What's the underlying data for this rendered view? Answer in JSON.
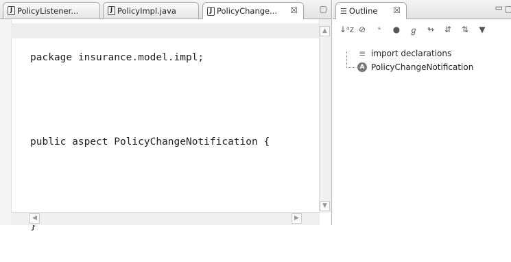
{
  "editor": {
    "tabs": [
      {
        "label": "PolicyListener...",
        "icon": "java-file-icon"
      },
      {
        "label": "PolicyImpl.java",
        "icon": "java-file-icon"
      },
      {
        "label": "PolicyChange...",
        "icon": "java-file-icon",
        "active": true
      }
    ],
    "tab_close_glyph": "☒",
    "code_lines": [
      "package insurance.model.impl;",
      "",
      "public aspect PolicyChangeNotification {",
      "",
      "}"
    ]
  },
  "outline": {
    "title": "Outline",
    "close_glyph": "☒",
    "toolbar": [
      {
        "name": "sort-icon",
        "glyph": "↓ᵃz"
      },
      {
        "name": "hide-fields-icon",
        "glyph": "⊘"
      },
      {
        "name": "hide-static-icon",
        "glyph": "ˢ"
      },
      {
        "name": "hide-nonpublic-icon",
        "glyph": "●"
      },
      {
        "name": "hide-local-types-icon",
        "glyph": "ℊ"
      },
      {
        "name": "link-icon",
        "glyph": "↬"
      },
      {
        "name": "sort-members-icon",
        "glyph": "⇵"
      },
      {
        "name": "sort-alpha-icon",
        "glyph": "⇅"
      },
      {
        "name": "view-menu-icon",
        "glyph": "▼"
      }
    ],
    "tree": [
      {
        "label": "import declarations",
        "icon": "imports-icon"
      },
      {
        "label": "PolicyChangeNotification",
        "icon": "aspect-icon",
        "icon_letter": "A"
      }
    ]
  },
  "colors": {
    "icon_fill": "#777777",
    "tab_border": "#a8a8a8"
  }
}
